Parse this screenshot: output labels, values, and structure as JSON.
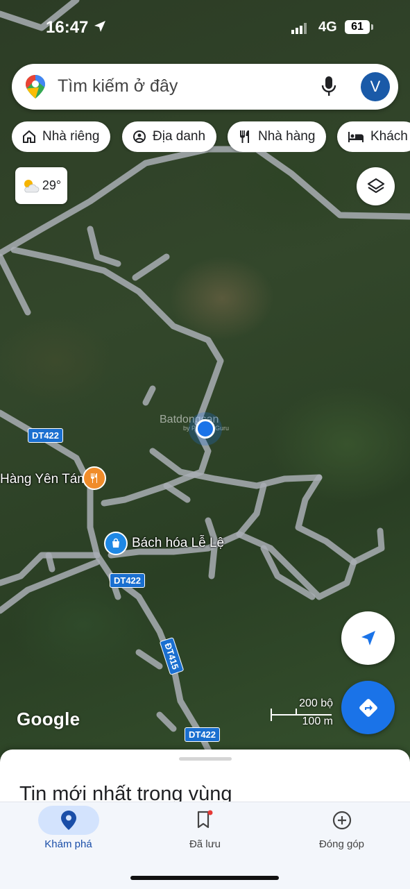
{
  "status_bar": {
    "time": "16:47",
    "network": "4G",
    "battery": "61"
  },
  "search": {
    "placeholder": "Tìm kiếm ở đây",
    "avatar_initial": "V"
  },
  "chips": [
    {
      "label": "Nhà riêng",
      "icon": "home-icon"
    },
    {
      "label": "Địa danh",
      "icon": "landmark-icon"
    },
    {
      "label": "Nhà hàng",
      "icon": "restaurant-icon"
    },
    {
      "label": "Khách",
      "icon": "hotel-icon"
    }
  ],
  "weather": {
    "temp": "29°",
    "icon": "partly-cloudy-icon"
  },
  "map": {
    "labels": {
      "restaurant": "Hàng Yên Tám",
      "store": "Bách hóa Lễ Lệ"
    },
    "roads": [
      "DT422",
      "DT422",
      "ĐT415",
      "DT422"
    ],
    "watermark": {
      "main": "Batdongsan",
      "sub": "by PropertyGuru",
      "suffix": ".com.vn"
    },
    "brand": "Google",
    "scale": {
      "imperial": "200 bộ",
      "metric": "100 m"
    }
  },
  "sheet": {
    "title": "Tin mới nhất trong vùng"
  },
  "bottom_nav": [
    {
      "label": "Khám phá",
      "icon": "explore-pin-icon",
      "active": true
    },
    {
      "label": "Đã lưu",
      "icon": "bookmark-icon",
      "active": false
    },
    {
      "label": "Đóng góp",
      "icon": "add-circle-icon",
      "active": false
    }
  ],
  "colors": {
    "accent": "#1a73e8",
    "poi_orange": "#f08c2a",
    "road_shield": "#1a6fd0"
  }
}
